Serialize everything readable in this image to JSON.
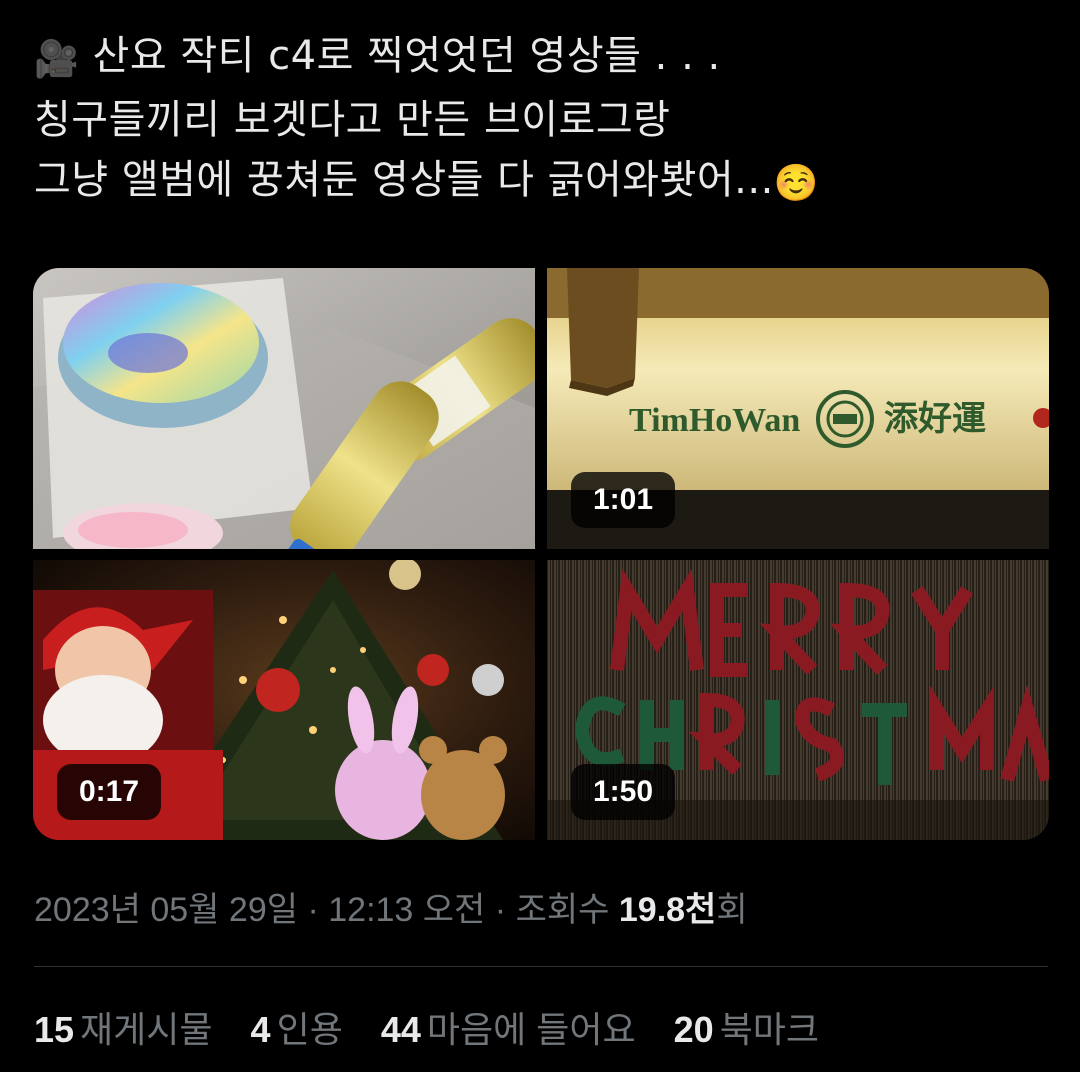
{
  "tweet": {
    "lines": [
      "산요 작티 c4로 찍엇엇던 영상들 . . .",
      "칭구들끼리 보겟다고 만든 브이로그랑",
      "그냥 앨범에 꿍쳐둔 영상들 다 긁어와봣어..."
    ],
    "lead_emoji": "🎥",
    "trail_emoji": "☺️"
  },
  "media": [
    {
      "name": "video-cake-drinks",
      "duration": ""
    },
    {
      "name": "video-timhowan",
      "duration": "1:01",
      "sign_text": "TimHoWan",
      "sign_text_cn": "添好運"
    },
    {
      "name": "video-christmas-tree",
      "duration": "0:17"
    },
    {
      "name": "video-merry-christmas",
      "duration": "1:50"
    }
  ],
  "meta": {
    "date": "2023년 05월 29일",
    "time": "12:13 오전",
    "views_label": "조회수",
    "views_count": "19.8천",
    "views_suffix": "회",
    "sep": "·"
  },
  "stats": [
    {
      "count": "15",
      "label": "재게시물"
    },
    {
      "count": "4",
      "label": "인용"
    },
    {
      "count": "44",
      "label": "마음에 들어요"
    },
    {
      "count": "20",
      "label": "북마크"
    }
  ],
  "colors": {
    "background": "#000000",
    "text": "#e7e9ea",
    "muted": "#71767b",
    "divider": "#2f3336"
  }
}
